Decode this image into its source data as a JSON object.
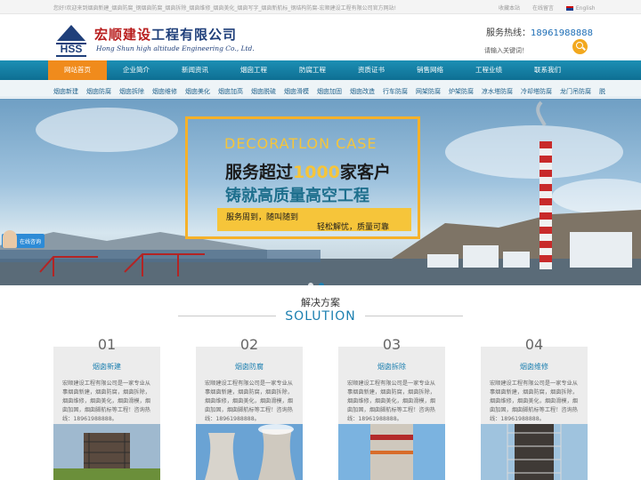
{
  "topbar": {
    "welcome": "您好!欢迎来到烟囱新建_烟囱防腐_钢烟囱防腐_烟囱拆除_烟囱维修_烟囱美化_烟囱写字_烟囱新航标_钢结构防腐-宏顺建设工程有限公司官方网站!",
    "links": [
      "收藏本站",
      "在线留言",
      "English"
    ]
  },
  "header": {
    "logo_cn_1": "宏顺建设",
    "logo_cn_2": "工程有限公司",
    "logo_en": "Hong Shun high altitude Engineering Co., Ltd.",
    "hotline_label": "服务热线：",
    "hotline_number": "18961988888",
    "search_placeholder": "请输入关键词！"
  },
  "nav": [
    "网站首页",
    "企业简介",
    "新闻资讯",
    "烟囱工程",
    "防腐工程",
    "资质证书",
    "销售网络",
    "工程业绩",
    "联系我们"
  ],
  "subnav": [
    "烟囱新建",
    "烟囱防腐",
    "烟囱拆除",
    "烟囱维修",
    "烟囱美化",
    "烟囱加高",
    "烟囱脱硫",
    "烟囱滑模",
    "烟囱加固",
    "烟囱改造",
    "行车防腐",
    "网架防腐",
    "炉架防腐",
    "凉水塔防腐",
    "冷却塔防腐",
    "龙门吊防腐",
    "脱"
  ],
  "banner": {
    "en_text": "DECORATLON CASE",
    "line1_a": "服务超过",
    "line1_hl": "1000",
    "line1_b": "家客户",
    "line2": "铸就高质量高空工程",
    "slogan1": "服务周到，随叫随到",
    "slogan2": "轻松解忧，质量可靠"
  },
  "chat": {
    "label": "在线咨询"
  },
  "solution": {
    "title": "解决方案",
    "title_en": "SOLUTION",
    "cards": [
      {
        "num": "01",
        "title": "烟囱新建",
        "desc": "宏顺建设工程有限公司是一家专业从事烟囱新建，烟囱防腐，烟囱拆除，烟囱维修，烟囱美化，烟囱滑模，烟囱加固，烟囱脚航标等工程！咨询热线：18961988888。"
      },
      {
        "num": "02",
        "title": "烟囱防腐",
        "desc": "宏顺建设工程有限公司是一家专业从事烟囱新建，烟囱防腐，烟囱拆除，烟囱维修，烟囱美化，烟囱滑模，烟囱加固，烟囱脚航标等工程！咨询热线：18961988888。"
      },
      {
        "num": "03",
        "title": "烟囱拆除",
        "desc": "宏顺建设工程有限公司是一家专业从事烟囱新建，烟囱防腐，烟囱拆除，烟囱维修，烟囱美化，烟囱滑模，烟囱加固，烟囱脚航标等工程！咨询热线：18961988888。"
      },
      {
        "num": "04",
        "title": "烟囱维修",
        "desc": "宏顺建设工程有限公司是一家专业从事烟囱新建，烟囱防腐，烟囱拆除，烟囱维修，烟囱美化，烟囱滑模，烟囱加固，烟囱脚航标等工程！咨询热线：18961988888。"
      }
    ]
  }
}
